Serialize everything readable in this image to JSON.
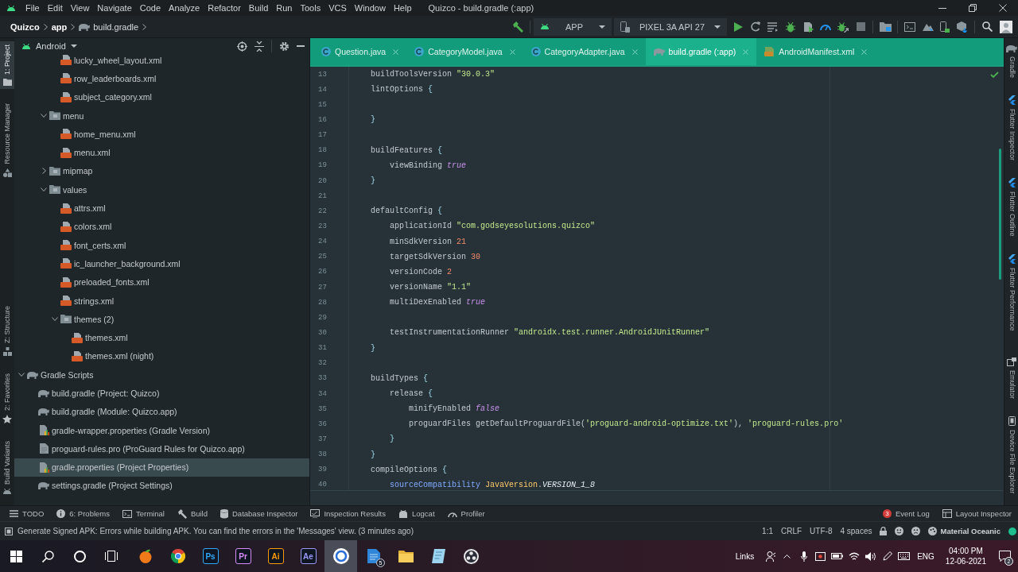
{
  "title_bar": {
    "menus": [
      "File",
      "Edit",
      "View",
      "Navigate",
      "Code",
      "Analyze",
      "Refactor",
      "Build",
      "Run",
      "Tools",
      "VCS",
      "Window",
      "Help"
    ],
    "title": "Quizco - build.gradle (:app)"
  },
  "breadcrumb": [
    {
      "label": "Quizco",
      "kind": "module"
    },
    {
      "label": "app",
      "kind": "module"
    },
    {
      "label": "build.gradle",
      "kind": "gradle"
    }
  ],
  "toolbar": {
    "run_config": "APP",
    "device": "PIXEL 3A API 27"
  },
  "left_strip": {
    "top": [
      {
        "label": "1: Project",
        "kind": "project",
        "selected": true
      },
      {
        "label": "Resource Manager",
        "kind": "resources",
        "selected": false
      }
    ],
    "bottom": [
      {
        "label": "Z: Structure",
        "kind": "structure",
        "selected": false
      },
      {
        "label": "2: Favorites",
        "kind": "favorites",
        "selected": false
      },
      {
        "label": "Build Variants",
        "kind": "variants",
        "selected": false
      }
    ]
  },
  "project_panel": {
    "view": "Android",
    "tree": [
      {
        "children": [
          {
            "children": [
              {
                "children": [
                  {
                    "label": "lucky_wheel_layout.xml",
                    "kind": "xml",
                    "selected": false
                  },
                  {
                    "label": "row_leaderboards.xml",
                    "kind": "xml",
                    "selected": false
                  },
                  {
                    "label": "subject_category.xml",
                    "kind": "xml",
                    "selected": false
                  }
                ]
              },
              {
                "label": "menu",
                "kind": "folder",
                "expanded": true,
                "selected": false,
                "children": [
                  {
                    "label": "home_menu.xml",
                    "kind": "xml",
                    "selected": false
                  },
                  {
                    "label": "menu.xml",
                    "kind": "xml",
                    "selected": false
                  }
                ]
              },
              {
                "label": "mipmap",
                "kind": "folder",
                "expanded": false,
                "selected": false
              },
              {
                "label": "values",
                "kind": "folder",
                "expanded": true,
                "selected": false,
                "children": [
                  {
                    "label": "attrs.xml",
                    "kind": "xml",
                    "selected": false
                  },
                  {
                    "label": "colors.xml",
                    "kind": "xml",
                    "selected": false
                  },
                  {
                    "label": "font_certs.xml",
                    "kind": "xml",
                    "selected": false
                  },
                  {
                    "label": "ic_launcher_background.xml",
                    "kind": "xml",
                    "selected": false
                  },
                  {
                    "label": "preloaded_fonts.xml",
                    "kind": "xml",
                    "selected": false
                  },
                  {
                    "label": "strings.xml",
                    "kind": "xml",
                    "selected": false
                  },
                  {
                    "label": "themes (2)",
                    "kind": "folder",
                    "expanded": true,
                    "selected": false,
                    "children": [
                      {
                        "label": "themes.xml",
                        "kind": "xml",
                        "selected": false
                      },
                      {
                        "label": "themes.xml (night)",
                        "kind": "xml",
                        "selected": false
                      }
                    ]
                  }
                ]
              }
            ]
          }
        ]
      },
      {
        "label": "Gradle Scripts",
        "kind": "gradle-folder",
        "expanded": true,
        "selected": false,
        "children": [
          {
            "label": "build.gradle (Project: Quizco)",
            "kind": "gradle",
            "selected": false
          },
          {
            "label": "build.gradle (Module: Quizco.app)",
            "kind": "gradle",
            "selected": false
          },
          {
            "label": "gradle-wrapper.properties (Gradle Version)",
            "kind": "properties",
            "selected": false
          },
          {
            "label": "proguard-rules.pro (ProGuard Rules for Quizco.app)",
            "kind": "pro",
            "selected": false
          },
          {
            "label": "gradle.properties (Project Properties)",
            "kind": "properties",
            "selected": true
          },
          {
            "label": "settings.gradle (Project Settings)",
            "kind": "gradle",
            "selected": false
          }
        ]
      }
    ]
  },
  "editor": {
    "tabs": [
      {
        "label": "Question.java",
        "kind": "java",
        "selected": false
      },
      {
        "label": "CategoryModel.java",
        "kind": "java",
        "selected": false
      },
      {
        "label": "CategoryAdapter.java",
        "kind": "java",
        "selected": false
      },
      {
        "label": "build.gradle (:app)",
        "kind": "gradle",
        "selected": true
      },
      {
        "label": "AndroidManifest.xml",
        "kind": "manifest",
        "selected": false
      }
    ],
    "lines": [
      {
        "number": "13",
        "tokens": [
          {
            "text": "    buildToolsVersion ",
            "kind": "plain"
          },
          {
            "text": "\"30.0.3\"",
            "kind": "string"
          }
        ]
      },
      {
        "number": "14",
        "tokens": [
          {
            "text": "    lintOptions ",
            "kind": "plain"
          },
          {
            "text": "{",
            "kind": "brace"
          }
        ]
      },
      {
        "number": "15"
      },
      {
        "number": "16",
        "tokens": [
          {
            "text": "    }",
            "kind": "brace"
          }
        ]
      },
      {
        "number": "17"
      },
      {
        "number": "18",
        "tokens": [
          {
            "text": "    buildFeatures ",
            "kind": "plain"
          },
          {
            "text": "{",
            "kind": "brace"
          }
        ]
      },
      {
        "number": "19",
        "tokens": [
          {
            "text": "        viewBinding ",
            "kind": "plain"
          },
          {
            "text": "true",
            "kind": "keyword"
          }
        ]
      },
      {
        "number": "20",
        "tokens": [
          {
            "text": "    }",
            "kind": "brace"
          }
        ]
      },
      {
        "number": "21"
      },
      {
        "number": "22",
        "tokens": [
          {
            "text": "    defaultConfig ",
            "kind": "plain"
          },
          {
            "text": "{",
            "kind": "brace"
          }
        ]
      },
      {
        "number": "23",
        "tokens": [
          {
            "text": "        applicationId ",
            "kind": "plain"
          },
          {
            "text": "\"com.godseyesolutions.quizco\"",
            "kind": "string"
          }
        ]
      },
      {
        "number": "24",
        "tokens": [
          {
            "text": "        minSdkVersion ",
            "kind": "plain"
          },
          {
            "text": "21",
            "kind": "number"
          }
        ]
      },
      {
        "number": "25",
        "tokens": [
          {
            "text": "        targetSdkVersion ",
            "kind": "plain"
          },
          {
            "text": "30",
            "kind": "number"
          }
        ]
      },
      {
        "number": "26",
        "tokens": [
          {
            "text": "        versionCode ",
            "kind": "plain"
          },
          {
            "text": "2",
            "kind": "number"
          }
        ]
      },
      {
        "number": "27",
        "tokens": [
          {
            "text": "        versionName ",
            "kind": "plain"
          },
          {
            "text": "\"1.1\"",
            "kind": "string"
          }
        ]
      },
      {
        "number": "28",
        "tokens": [
          {
            "text": "        multiDexEnabled ",
            "kind": "plain"
          },
          {
            "text": "true",
            "kind": "keyword"
          }
        ]
      },
      {
        "number": "29"
      },
      {
        "number": "30",
        "tokens": [
          {
            "text": "        testInstrumentationRunner ",
            "kind": "plain"
          },
          {
            "text": "\"androidx.test.runner.AndroidJUnitRunner\"",
            "kind": "string"
          }
        ]
      },
      {
        "number": "31",
        "tokens": [
          {
            "text": "    }",
            "kind": "brace"
          }
        ]
      },
      {
        "number": "32"
      },
      {
        "number": "33",
        "tokens": [
          {
            "text": "    buildTypes ",
            "kind": "plain"
          },
          {
            "text": "{",
            "kind": "brace"
          }
        ]
      },
      {
        "number": "34",
        "tokens": [
          {
            "text": "        release ",
            "kind": "plain"
          },
          {
            "text": "{",
            "kind": "brace"
          }
        ]
      },
      {
        "number": "35",
        "tokens": [
          {
            "text": "            minifyEnabled ",
            "kind": "plain"
          },
          {
            "text": "false",
            "kind": "keyword"
          }
        ]
      },
      {
        "number": "36",
        "tokens": [
          {
            "text": "            proguardFiles getDefaultProguardFile(",
            "kind": "plain"
          },
          {
            "text": "'proguard-android-optimize.txt'",
            "kind": "string"
          },
          {
            "text": "), ",
            "kind": "plain"
          },
          {
            "text": "'proguard-rules.pro'",
            "kind": "string"
          }
        ]
      },
      {
        "number": "37",
        "tokens": [
          {
            "text": "        }",
            "kind": "brace"
          }
        ]
      },
      {
        "number": "38",
        "tokens": [
          {
            "text": "    }",
            "kind": "brace"
          }
        ]
      },
      {
        "number": "39",
        "tokens": [
          {
            "text": "    compileOptions ",
            "kind": "plain"
          },
          {
            "text": "{",
            "kind": "brace"
          }
        ]
      },
      {
        "number": "40",
        "tokens": [
          {
            "text": "        sourceCompatibility ",
            "kind": "field"
          },
          {
            "text": "JavaVersion",
            "kind": "class"
          },
          {
            "text": ".",
            "kind": "plain"
          },
          {
            "text": "VERSION_1_8",
            "kind": "constant"
          }
        ]
      }
    ]
  },
  "right_strip": {
    "top": [
      {
        "label": "Gradle",
        "kind": "gradle",
        "selected": false
      },
      {
        "label": "Flutter Inspector",
        "kind": "flutter",
        "selected": false
      },
      {
        "label": "Flutter Outline",
        "kind": "flutter",
        "selected": false
      },
      {
        "label": "Flutter Performance",
        "kind": "flutter",
        "selected": false
      }
    ],
    "bottom": [
      {
        "label": "Emulator",
        "kind": "emulator",
        "selected": false
      },
      {
        "label": "Device File Explorer",
        "kind": "device",
        "selected": false
      }
    ]
  },
  "tool_windows": {
    "left": [
      {
        "label": "TODO",
        "kind": "todo"
      },
      {
        "label": "6: Problems",
        "kind": "problems"
      },
      {
        "label": "Terminal",
        "kind": "terminal"
      },
      {
        "label": "Build",
        "kind": "build"
      },
      {
        "label": "Database Inspector",
        "kind": "database"
      },
      {
        "label": "Inspection Results",
        "kind": "inspection"
      },
      {
        "label": "Logcat",
        "kind": "logcat"
      },
      {
        "label": "Profiler",
        "kind": "profiler"
      }
    ],
    "right": [
      {
        "label": "Event Log",
        "kind": "event-log",
        "count": "3"
      },
      {
        "label": "Layout Inspector",
        "kind": "layout-inspector"
      }
    ]
  },
  "status_bar": {
    "message": "Generate Signed APK: Errors while building APK. You can find the errors in the 'Messages' view. (3 minutes ago)",
    "items": [
      "1:1",
      "CRLF",
      "UTF-8",
      "4 spaces"
    ],
    "theme": "Material Oceanic"
  },
  "taskbar": {
    "apps": [
      {
        "kind": "fruit",
        "selected": false
      },
      {
        "kind": "browser",
        "selected": false
      },
      {
        "kind": "tile",
        "label": "Ps",
        "color": "#31a8ff",
        "selected": false
      },
      {
        "kind": "tile",
        "label": "Pr",
        "color": "#d98cff",
        "selected": false
      },
      {
        "kind": "tile",
        "label": "Ai",
        "color": "#ff9a00",
        "selected": false
      },
      {
        "kind": "tile",
        "label": "Ae",
        "color": "#9999ff",
        "selected": false
      },
      {
        "kind": "round",
        "selected": true
      },
      {
        "kind": "document",
        "badge": "5",
        "selected": false
      },
      {
        "kind": "folder",
        "selected": false
      },
      {
        "kind": "notepad",
        "selected": false
      },
      {
        "kind": "ring",
        "selected": false
      }
    ],
    "tray": {
      "links": "Links",
      "language": "ENG",
      "time": "04:00 PM",
      "date": "12-06-2021",
      "notifications": "2"
    }
  }
}
